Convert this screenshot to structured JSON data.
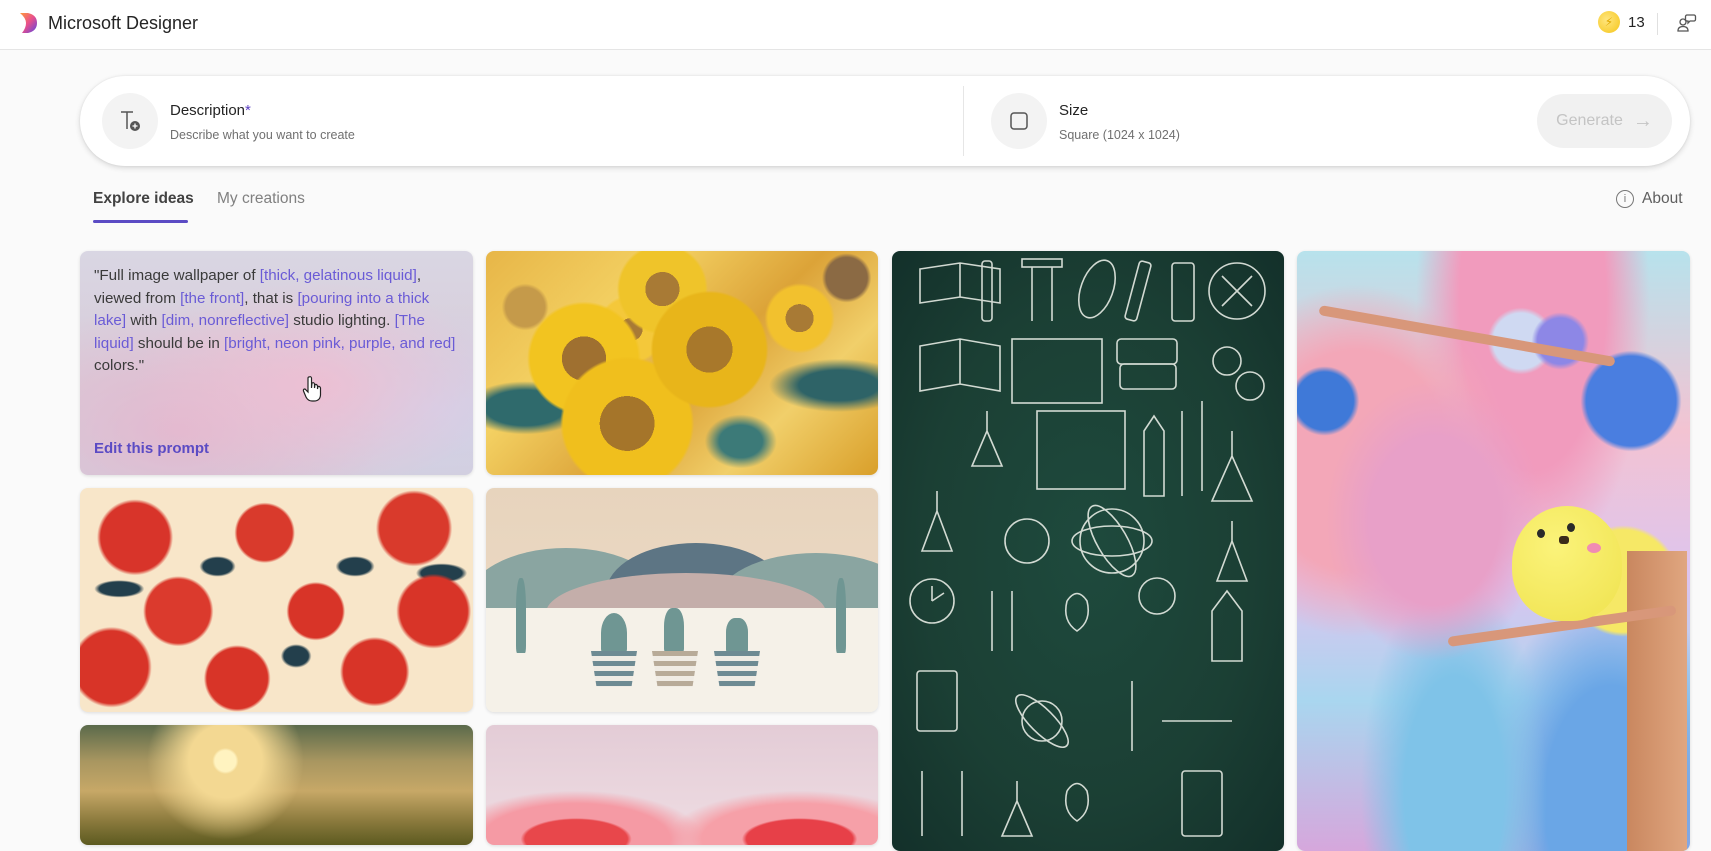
{
  "app": {
    "title": "Microsoft Designer",
    "logo_icon": "designer-logo-icon",
    "credits": "13",
    "credits_icon": "boost-coin-icon",
    "account_icon": "people-chat-icon"
  },
  "prompt_bar": {
    "description": {
      "label": "Description",
      "required_mark": "*",
      "hint": "Describe what you want to create",
      "icon": "text-add-icon"
    },
    "size": {
      "label": "Size",
      "value": "Square (1024 x 1024)",
      "icon": "square-icon"
    },
    "generate": {
      "label": "Generate",
      "arrow": "→",
      "enabled": false
    }
  },
  "tabs": [
    {
      "label": "Explore ideas",
      "active": true
    },
    {
      "label": "My creations",
      "active": false
    }
  ],
  "about": {
    "label": "About",
    "icon": "info-icon",
    "glyph": "i"
  },
  "gallery": {
    "prompt_card": {
      "segments": [
        {
          "text": "\"Full image wallpaper of ",
          "hl": false
        },
        {
          "text": "[thick, gelatinous liquid]",
          "hl": true
        },
        {
          "text": ", viewed from ",
          "hl": false
        },
        {
          "text": "[the front]",
          "hl": true
        },
        {
          "text": ", that is ",
          "hl": false
        },
        {
          "text": "[pouring into a thick lake]",
          "hl": true
        },
        {
          "text": " with ",
          "hl": false
        },
        {
          "text": "[dim, nonreflective]",
          "hl": true
        },
        {
          "text": " studio lighting. ",
          "hl": false
        },
        {
          "text": "[The liquid]",
          "hl": true
        },
        {
          "text": " should be in ",
          "hl": false
        },
        {
          "text": "[bright, neon pink, purple, and red]",
          "hl": true
        },
        {
          "text": " colors.\"",
          "hl": false
        }
      ],
      "edit_label": "Edit this prompt"
    },
    "images": [
      {
        "name": "sunflowers",
        "alt": "Swirling sunflower wallpaper"
      },
      {
        "name": "chalkboard-science",
        "alt": "Chalkboard science doodles"
      },
      {
        "name": "yellow-bird",
        "alt": "Yellow bird on flowering branch"
      },
      {
        "name": "apple-pattern",
        "alt": "Red apple pattern"
      },
      {
        "name": "cactus-landscape",
        "alt": "Potted cacti desert landscape"
      },
      {
        "name": "sunset-field",
        "alt": "Sunset over grass field"
      },
      {
        "name": "pink-trees",
        "alt": "Pink autumn trees"
      }
    ]
  },
  "colors": {
    "accent": "#5b4bc4",
    "highlight": "#6a5bd6"
  }
}
